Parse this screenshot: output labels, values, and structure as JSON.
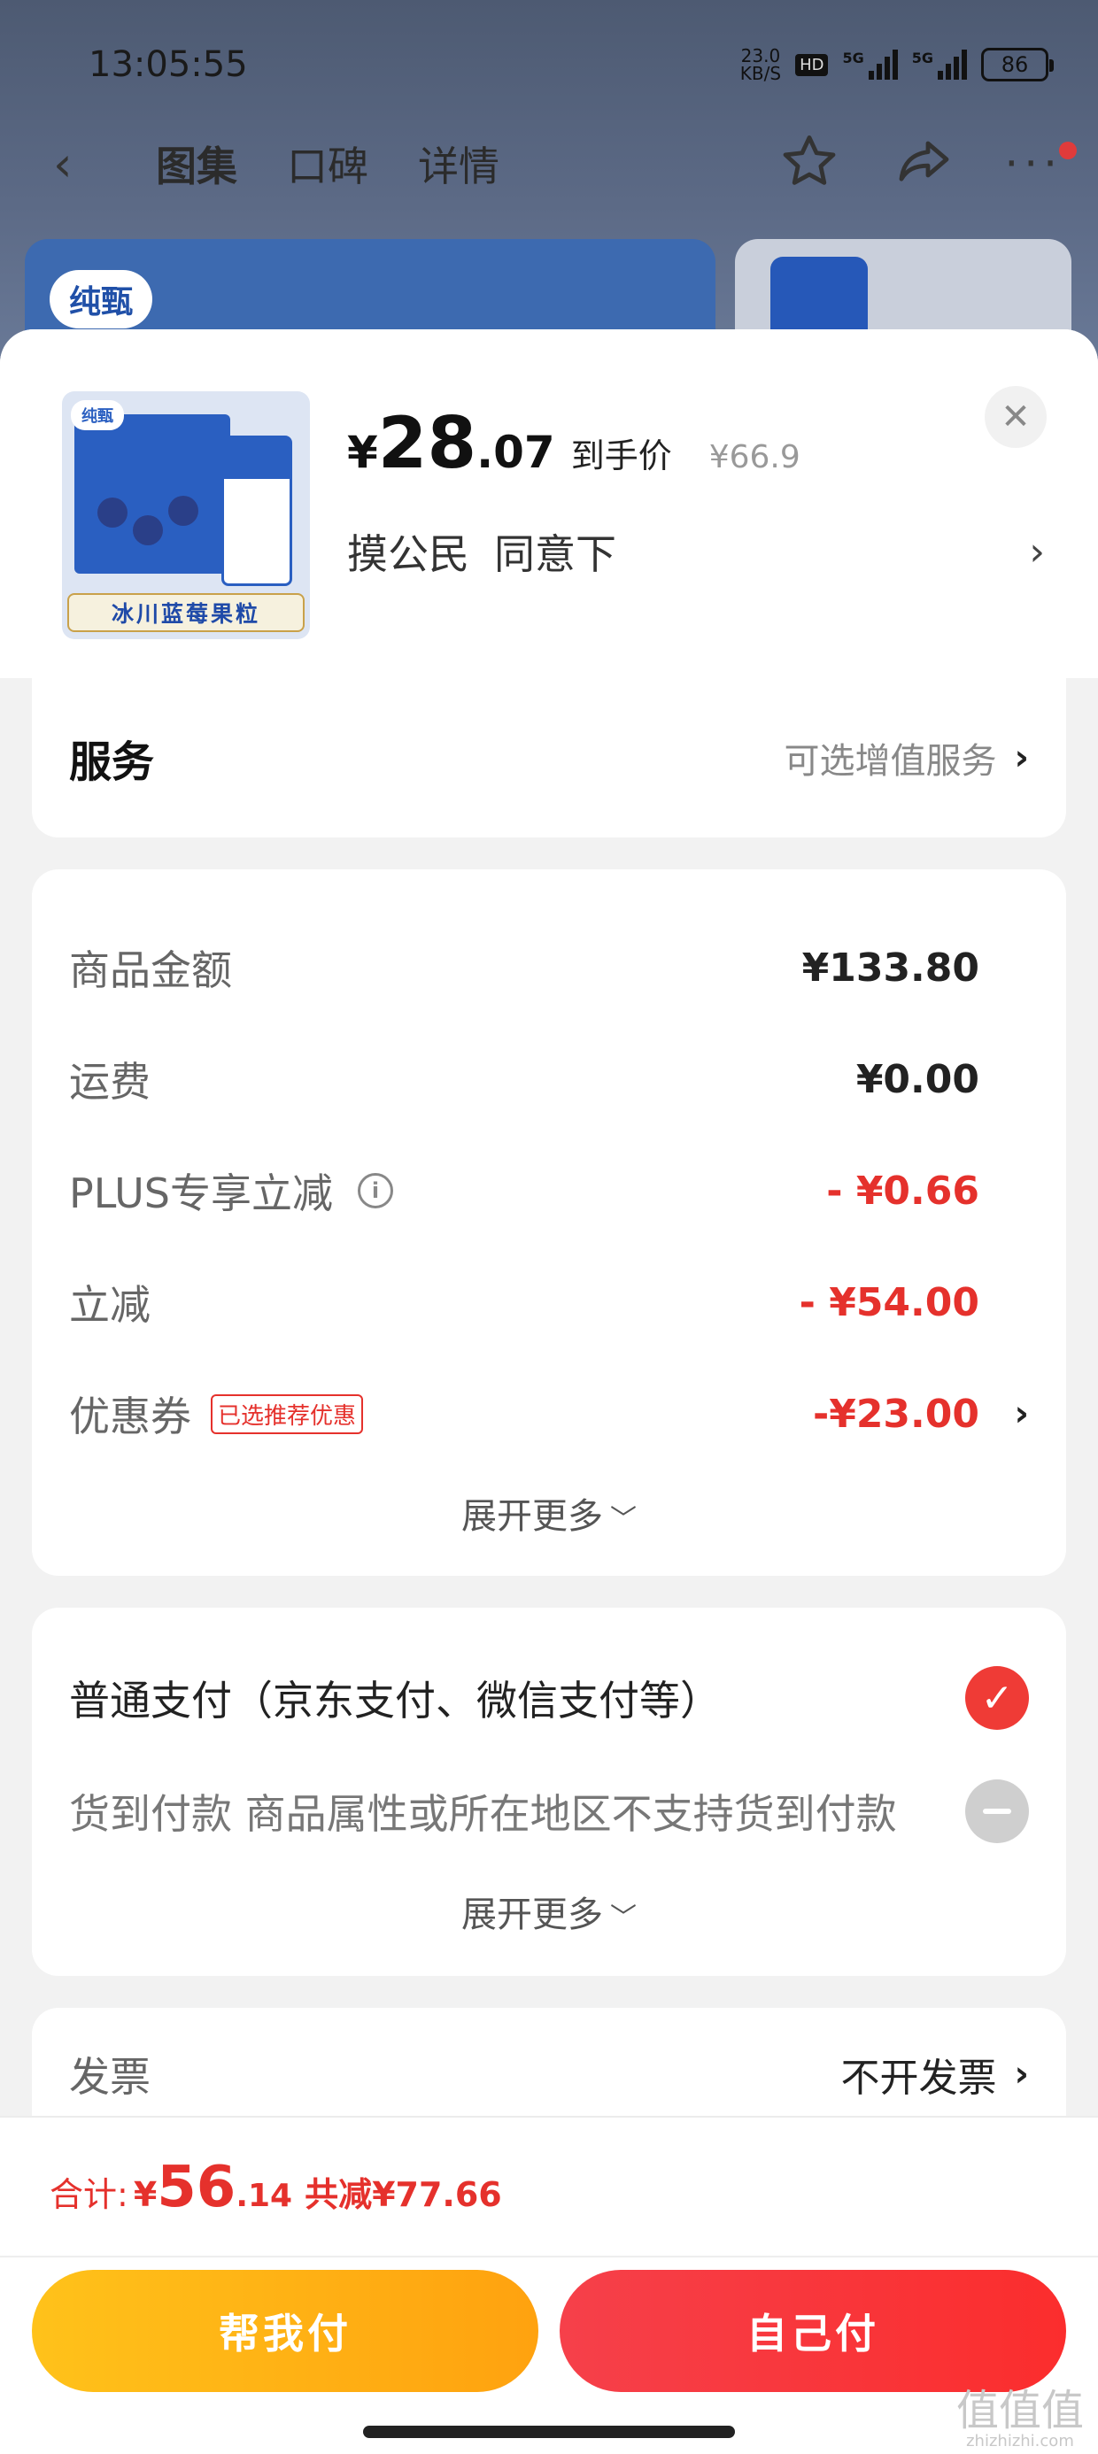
{
  "status_bar": {
    "time": "13:05:55",
    "net_speed": "23.0",
    "net_unit": "KB/S",
    "hd": "HD",
    "sig1": "5G",
    "sig2": "5G",
    "battery": "86"
  },
  "nav": {
    "tabs": [
      "图集",
      "口碑",
      "详情"
    ]
  },
  "background": {
    "brand": "纯甄"
  },
  "product": {
    "thumb_brand": "纯甄",
    "thumb_banner": "冰川蓝莓果粒",
    "currency": "¥",
    "price_int": "28",
    "price_dec": ".07",
    "price_tag": "到手价",
    "original_price": "¥66.9",
    "address_name": "摸公民",
    "address_detail": "同意下",
    "chevron": "›"
  },
  "service": {
    "title": "服务",
    "hint": "可选增值服务"
  },
  "amounts": {
    "rows": [
      {
        "label": "商品金额",
        "value": "¥133.80"
      },
      {
        "label": "运费",
        "value": "¥0.00"
      },
      {
        "label": "PLUS专享立减",
        "value": "- ¥0.66"
      },
      {
        "label": "立减",
        "value": "- ¥54.00"
      },
      {
        "label": "优惠券",
        "badge": "已选推荐优惠",
        "value": "-¥23.00"
      }
    ],
    "info_glyph": "i",
    "expand": "展开更多"
  },
  "payment": {
    "option_normal": "普通支付（京东支付、微信支付等）",
    "option_cod": "货到付款 商品属性或所在地区不支持货到付款",
    "expand": "展开更多"
  },
  "invoice": {
    "label": "发票",
    "value": "不开发票"
  },
  "footer": {
    "total_label": "合计:",
    "currency": "¥",
    "total_int": "56",
    "total_dec": ".14",
    "saved": "共减¥77.66",
    "help_pay": "帮我付",
    "self_pay": "自己付"
  },
  "watermark": {
    "text": "值值值",
    "site": "zhizhizhi.com"
  },
  "colors": {
    "accent_red": "#e5312c",
    "pay_yellow": "#ffb116",
    "pay_red": "#f6404a"
  }
}
